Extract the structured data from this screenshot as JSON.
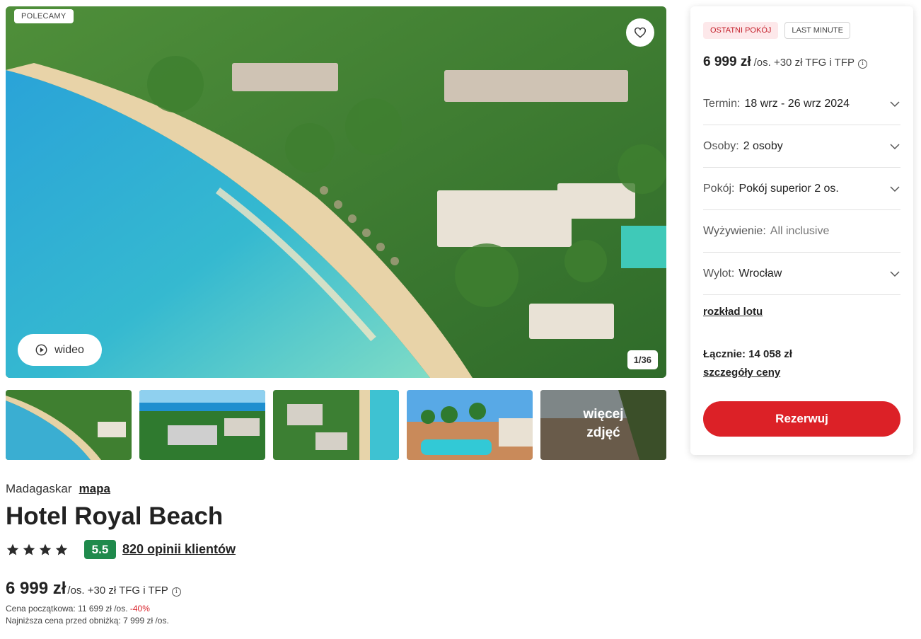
{
  "gallery": {
    "badge": "POLECAMY",
    "video_label": "wideo",
    "counter": "1/36",
    "more_photos_line1": "więcej",
    "more_photos_line2": "zdjęć"
  },
  "hotel": {
    "location": "Madagaskar",
    "map_link": "mapa",
    "name": "Hotel Royal Beach",
    "stars": 4,
    "score": "5.5",
    "reviews": "820 opinii klientów",
    "price": "6 999 zł",
    "price_suffix": "/os. +30 zł TFG i TFP",
    "original_price_label": "Cena początkowa: 11 699 zł /os.",
    "discount": "-40%",
    "lowest_price_label": "Najniższa cena przed obniżką: 7 999 zł /os."
  },
  "booking": {
    "tag_last_room": "OSTATNI POKÓJ",
    "tag_last_minute": "LAST MINUTE",
    "price": "6 999 zł",
    "price_suffix": "/os. +30 zł TFG i TFP",
    "rows": [
      {
        "label": "Termin:",
        "value": "18 wrz - 26 wrz 2024"
      },
      {
        "label": "Osoby:",
        "value": "2 osoby"
      },
      {
        "label": "Pokój:",
        "value": "Pokój superior 2 os."
      },
      {
        "label": "Wyżywienie:",
        "value": "All inclusive"
      },
      {
        "label": "Wylot:",
        "value": "Wrocław"
      }
    ],
    "flight_schedule": "rozkład lotu",
    "total": "Łącznie: 14 058 zł",
    "price_details": "szczegóły ceny",
    "book_button": "Rezerwuj"
  },
  "colors": {
    "accent": "#dc2127",
    "score_badge": "#1f8a4c",
    "discount": "#d9252d"
  },
  "icons": [
    "heart-icon",
    "play-icon",
    "star-icon",
    "info-icon",
    "chevron-down-icon"
  ]
}
